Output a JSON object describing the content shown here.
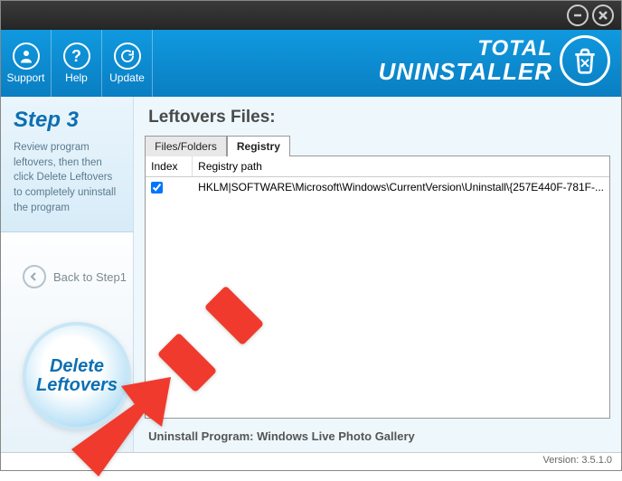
{
  "window": {
    "title": "Total Uninstaller"
  },
  "titlebar": {
    "minimize": "minimize",
    "close": "close"
  },
  "header": {
    "support": "Support",
    "help": "Help",
    "update": "Update",
    "brand_top": "TOTAL",
    "brand_bottom": "UNINSTALLER"
  },
  "sidebar": {
    "step_title": "Step 3",
    "step_text": "Review program leftovers, then then click Delete Leftovers to completely uninstall the program",
    "back_label": "Back to Step1",
    "delete_line1": "Delete",
    "delete_line2": "Leftovers"
  },
  "main": {
    "title": "Leftovers Files:",
    "tabs": [
      {
        "label": "Files/Folders",
        "active": false
      },
      {
        "label": "Registry",
        "active": true
      }
    ],
    "columns": {
      "index": "Index",
      "path": "Registry path"
    },
    "rows": [
      {
        "checked": true,
        "path": "HKLM|SOFTWARE\\Microsoft\\Windows\\CurrentVersion\\Uninstall\\{257E440F-781F-..."
      }
    ],
    "footer_prefix": "Uninstall Program: ",
    "footer_program": "Windows Live Photo Gallery"
  },
  "statusbar": {
    "version": "Version: 3.5.1.0"
  },
  "colors": {
    "accent": "#0d6fb2",
    "headerTop": "#1099df",
    "headerBottom": "#0a7ec2",
    "annotation": "#f03a2d"
  }
}
